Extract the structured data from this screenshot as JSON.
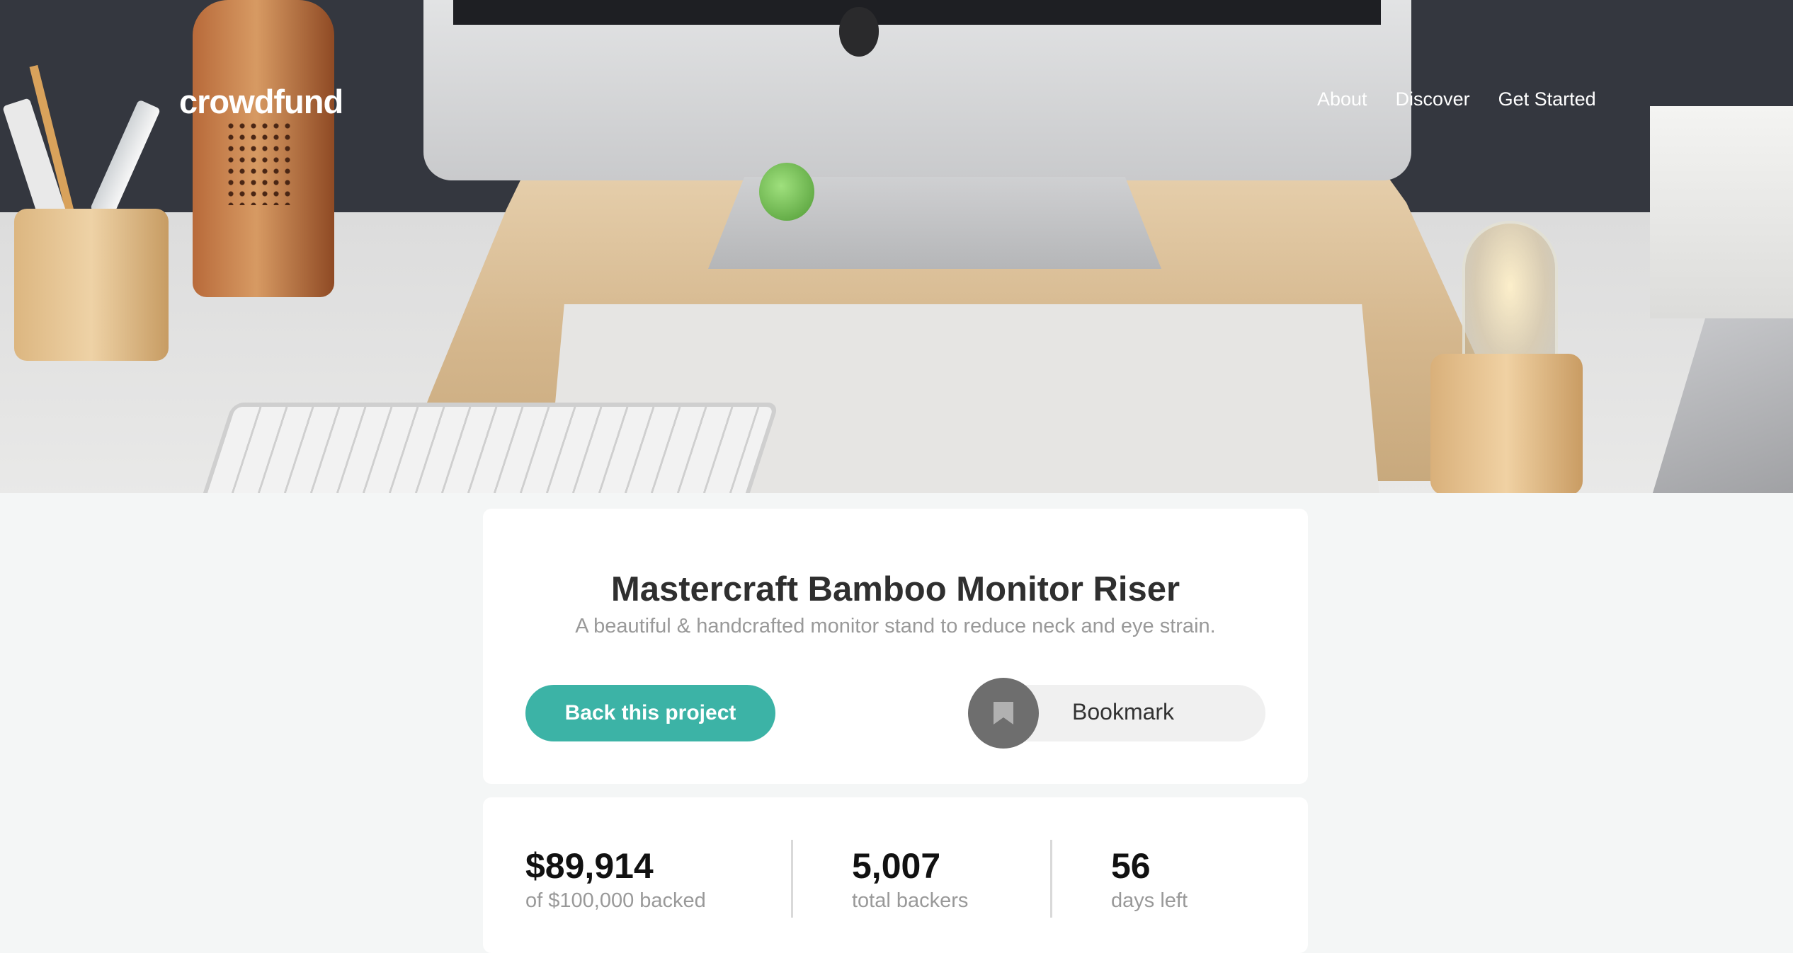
{
  "brand": "crowdfund",
  "nav": {
    "about": "About",
    "discover": "Discover",
    "get_started": "Get Started"
  },
  "project": {
    "title": "Mastercraft Bamboo Monitor Riser",
    "subtitle": "A beautiful & handcrafted monitor stand to reduce neck and eye strain.",
    "back_label": "Back this project",
    "bookmark_label": "Bookmark",
    "bookmark_icon": "bookmark-icon"
  },
  "stats": [
    {
      "value": "$89,914",
      "label": "of $100,000 backed"
    },
    {
      "value": "5,007",
      "label": "total backers"
    },
    {
      "value": "56",
      "label": "days left"
    }
  ],
  "colors": {
    "accent": "#3cb3a6",
    "bookmark_circle": "#6e6e6e",
    "page_bg": "#f4f6f6"
  }
}
